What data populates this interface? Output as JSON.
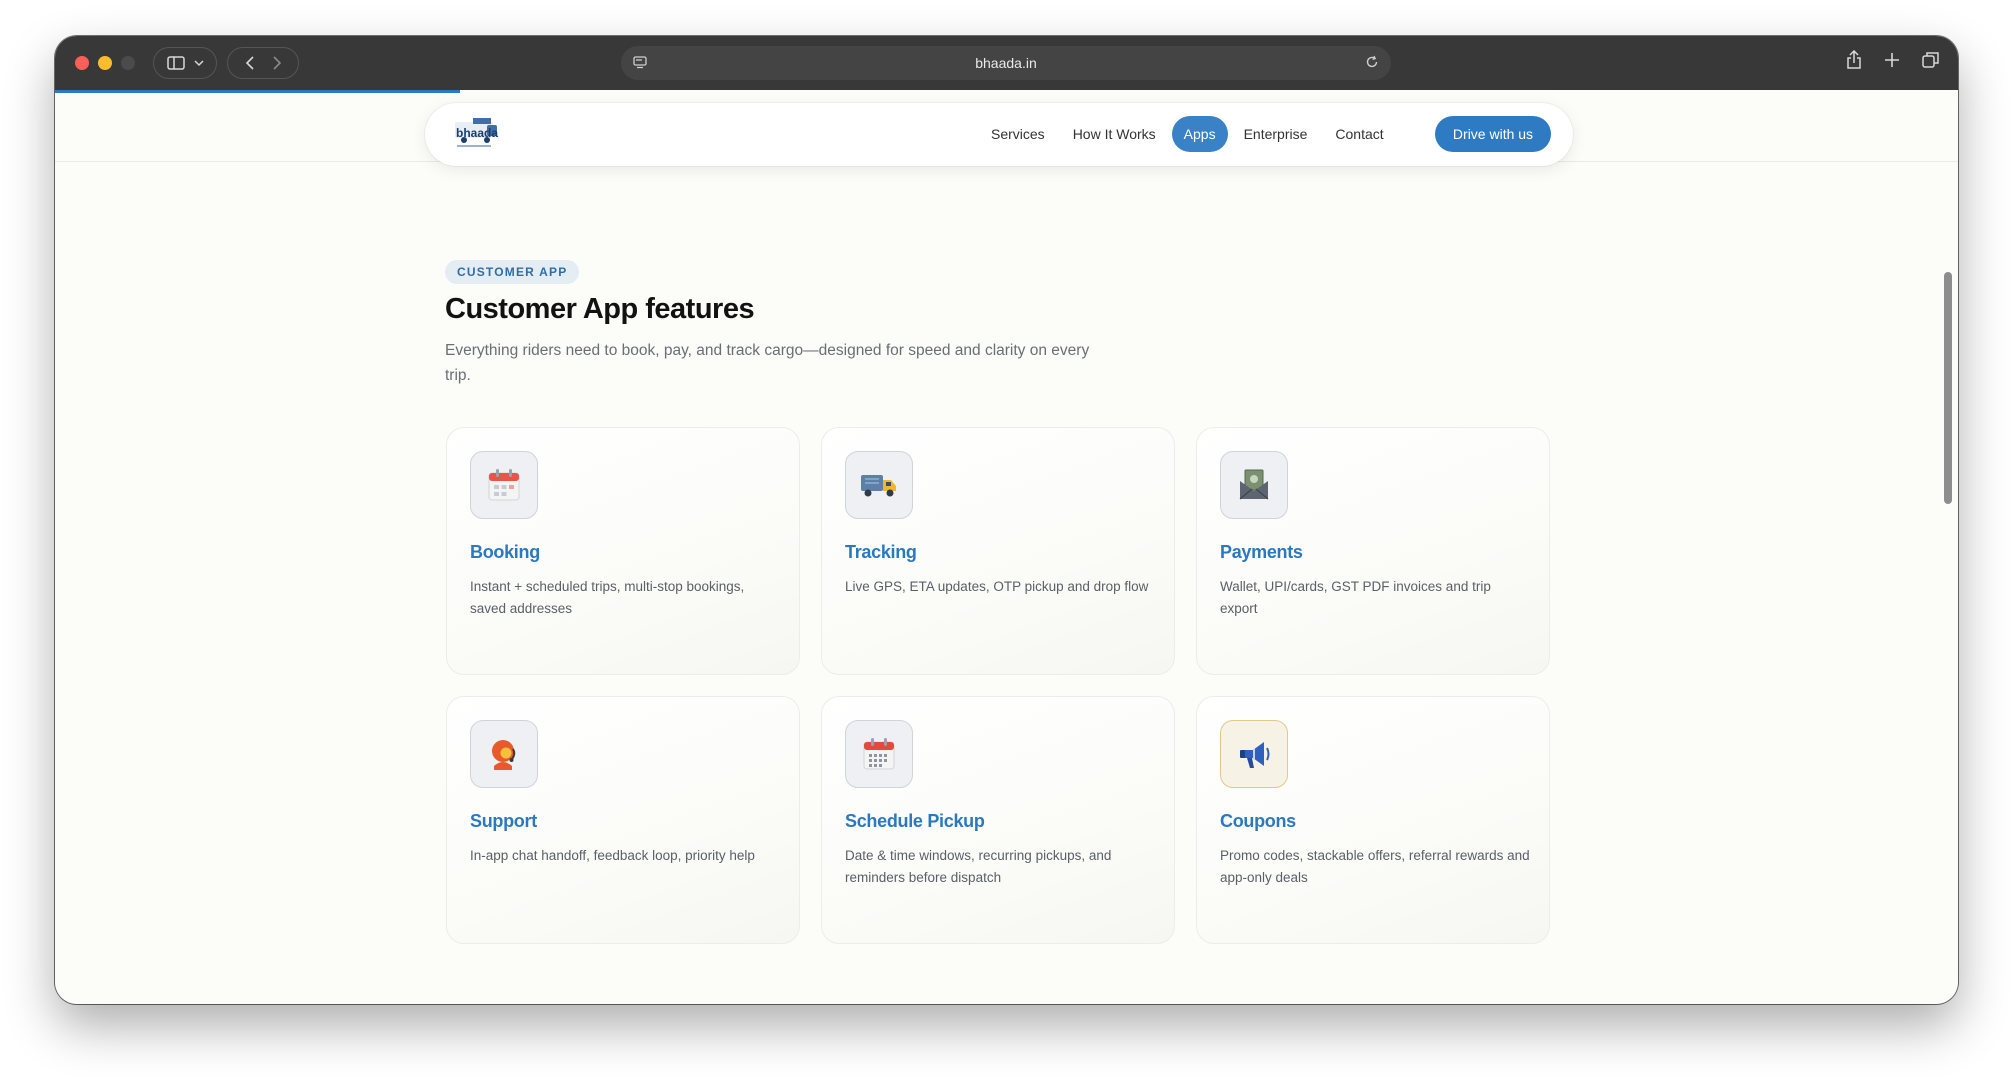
{
  "browser": {
    "url": "bhaada.in"
  },
  "nav": {
    "logo_text": "bhaada",
    "links": [
      "Services",
      "How It Works",
      "Apps",
      "Enterprise",
      "Contact"
    ],
    "active": "Apps",
    "cta": "Drive with us"
  },
  "section": {
    "eyebrow": "CUSTOMER APP",
    "title": "Customer App features",
    "subtitle": "Everything riders need to book, pay, and track cargo—designed for speed and clarity on every trip."
  },
  "features": [
    {
      "title": "Booking",
      "desc": "Instant + scheduled trips, multi-stop bookings, saved addresses",
      "icon": "calendar-icon"
    },
    {
      "title": "Tracking",
      "desc": "Live GPS, ETA updates, OTP pickup and drop flow",
      "icon": "delivery-truck-icon"
    },
    {
      "title": "Payments",
      "desc": "Wallet, UPI/cards, GST PDF invoices and trip export",
      "icon": "money-envelope-icon"
    },
    {
      "title": "Support",
      "desc": "In-app chat handoff, feedback loop, priority help",
      "icon": "support-agent-icon"
    },
    {
      "title": "Schedule Pickup",
      "desc": "Date & time windows, recurring pickups, and reminders before dispatch",
      "icon": "calendar-grid-icon"
    },
    {
      "title": "Coupons",
      "desc": "Promo codes, stackable offers, referral rewards and app-only deals",
      "icon": "megaphone-icon"
    }
  ],
  "colors": {
    "accent": "#2e7bc4",
    "background": "#fcfcf8",
    "card_title": "#2c78bf"
  }
}
